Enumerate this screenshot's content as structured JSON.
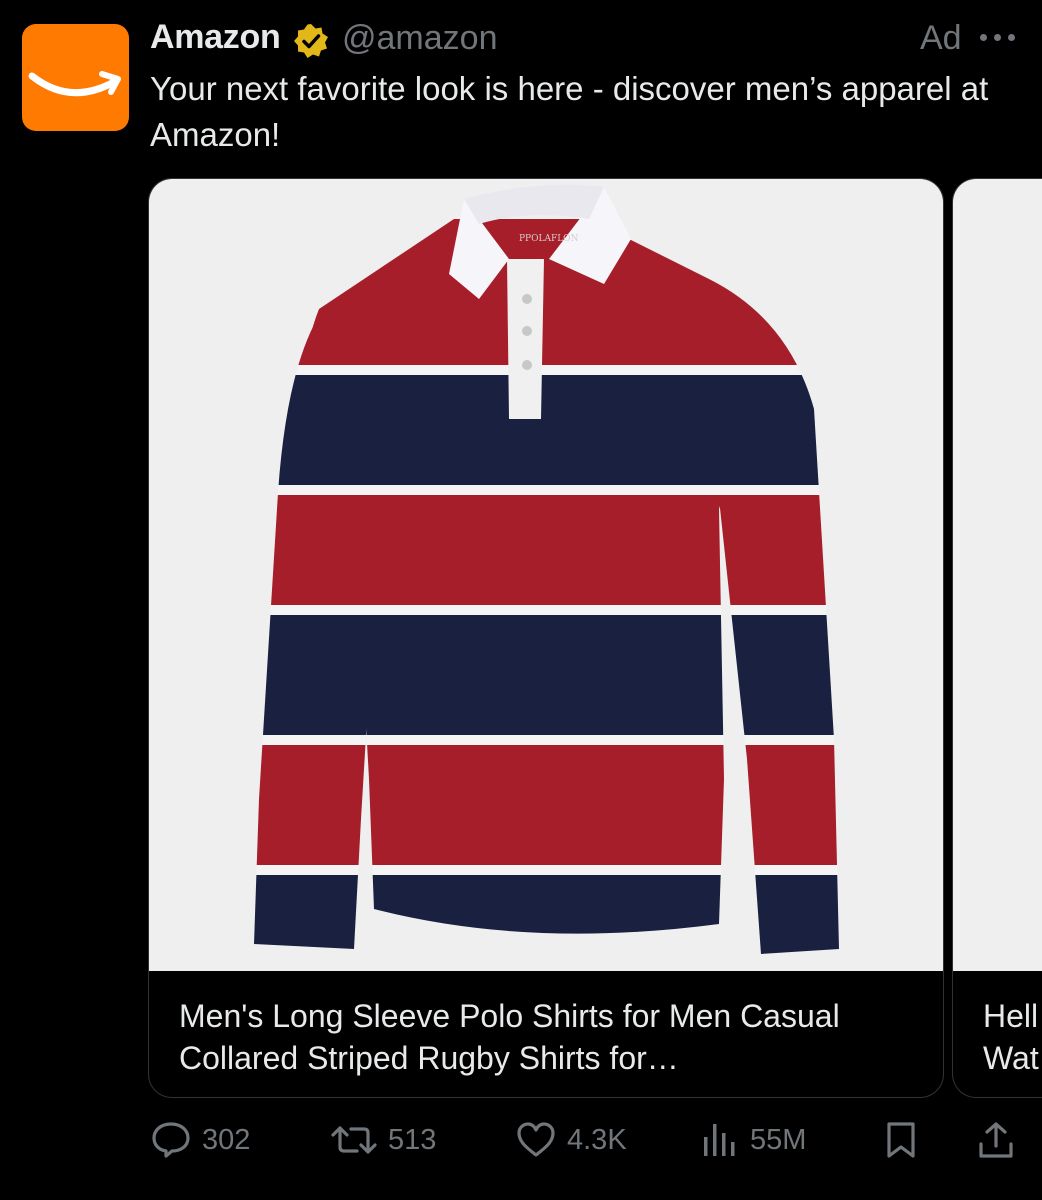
{
  "account": {
    "name": "Amazon",
    "handle": "@amazon",
    "ad_label": "Ad",
    "brand_color": "#ff7a00",
    "verified_color": "#e2b719"
  },
  "tweet": {
    "text": "Your next favorite look is here - discover men’s apparel at Amazon!"
  },
  "carousel": {
    "cards": [
      {
        "title": "Men's Long Sleeve Polo Shirts for Men Casual Collared Striped Rugby Shirts for…",
        "image": "red-navy-striped-rugby-polo-shirt",
        "tag_text": "PPOLAFLON"
      },
      {
        "title_partial": "Hell\nWat"
      }
    ]
  },
  "actions": {
    "replies": "302",
    "reposts": "513",
    "likes": "4.3K",
    "views": "55M"
  },
  "icons": [
    "amazon-smile-icon",
    "verified-badge-icon",
    "more-icon",
    "reply-icon",
    "repost-icon",
    "like-icon",
    "views-icon",
    "bookmark-icon",
    "share-icon"
  ]
}
